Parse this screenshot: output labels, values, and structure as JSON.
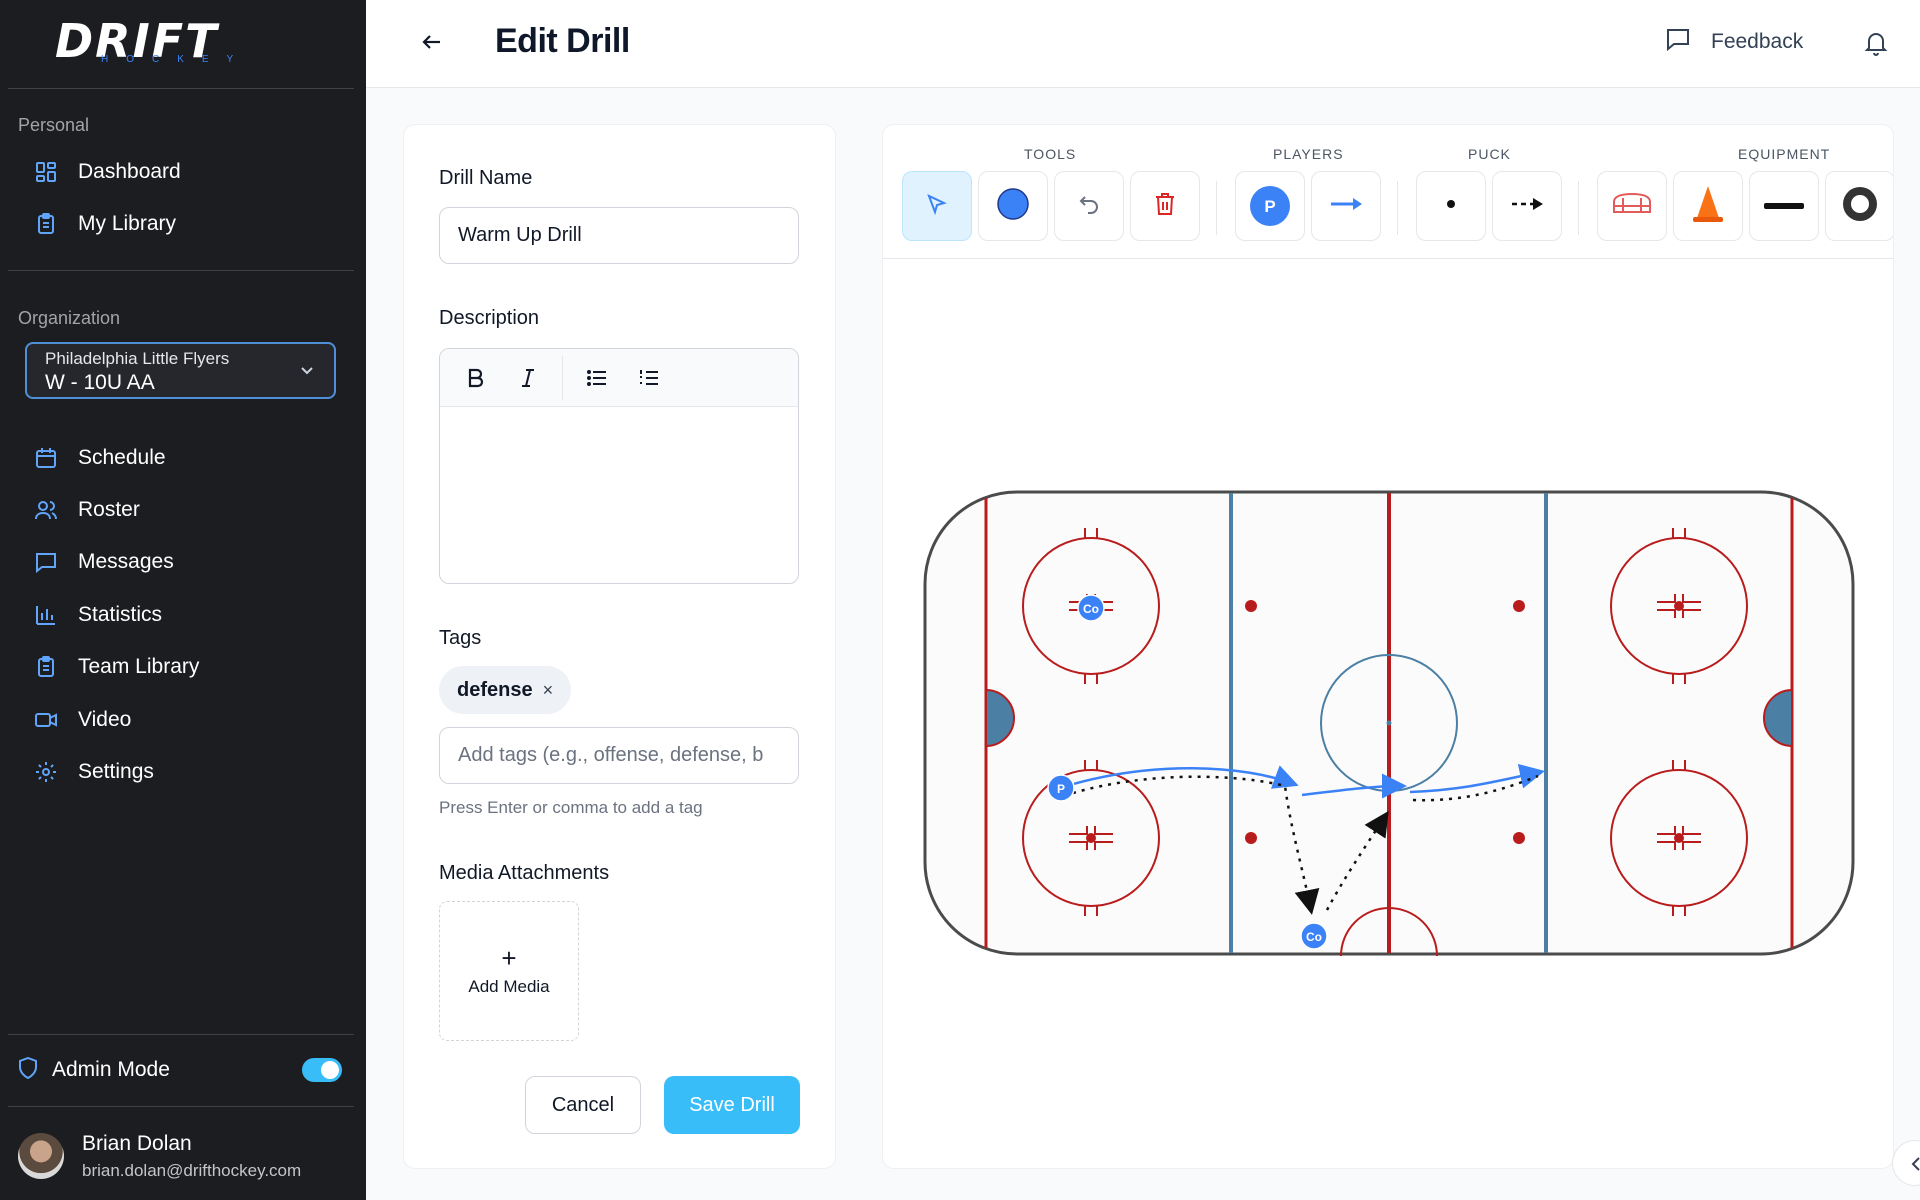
{
  "brand": {
    "logo_text": "DRIFT",
    "logo_sub": "HOCKEY"
  },
  "sidebar": {
    "personal_label": "Personal",
    "personal_items": [
      {
        "label": "Dashboard",
        "icon": "dashboard-icon"
      },
      {
        "label": "My Library",
        "icon": "clipboard-icon"
      }
    ],
    "organization_label": "Organization",
    "org_select": {
      "org": "Philadelphia Little Flyers",
      "team": "W - 10U AA"
    },
    "org_items": [
      {
        "label": "Schedule",
        "icon": "calendar-icon"
      },
      {
        "label": "Roster",
        "icon": "users-icon"
      },
      {
        "label": "Messages",
        "icon": "message-icon"
      },
      {
        "label": "Statistics",
        "icon": "bar-chart-icon"
      },
      {
        "label": "Team Library",
        "icon": "clipboard-icon"
      },
      {
        "label": "Video",
        "icon": "video-icon"
      },
      {
        "label": "Settings",
        "icon": "gear-icon"
      }
    ],
    "admin_mode": {
      "label": "Admin Mode",
      "enabled": true
    },
    "user": {
      "name": "Brian Dolan",
      "email": "brian.dolan@drifthockey.com"
    }
  },
  "header": {
    "title": "Edit Drill",
    "feedback_label": "Feedback"
  },
  "form": {
    "drill_name_label": "Drill Name",
    "drill_name_value": "Warm Up Drill",
    "description_label": "Description",
    "description_value": "",
    "tags_label": "Tags",
    "tags": [
      "defense"
    ],
    "tag_remove_glyph": "×",
    "tags_placeholder": "Add tags (e.g., offense, defense, b",
    "tags_hint": "Press Enter or comma to add a tag",
    "media_label": "Media Attachments",
    "add_media_label": "Add Media",
    "add_media_glyph": "+",
    "cancel_label": "Cancel",
    "save_label": "Save Drill"
  },
  "editor": {
    "groups": {
      "tools": "TOOLS",
      "players": "PLAYERS",
      "puck": "PUCK",
      "equipment": "EQUIPMENT"
    },
    "player_token_label": "P",
    "coach_token_label": "Co",
    "colors": {
      "accent": "#3b82f6",
      "red_line": "#b91c1c",
      "blue_line": "#4b7fa3",
      "save": "#38bdf8",
      "sidebar": "#1c1d21"
    }
  }
}
